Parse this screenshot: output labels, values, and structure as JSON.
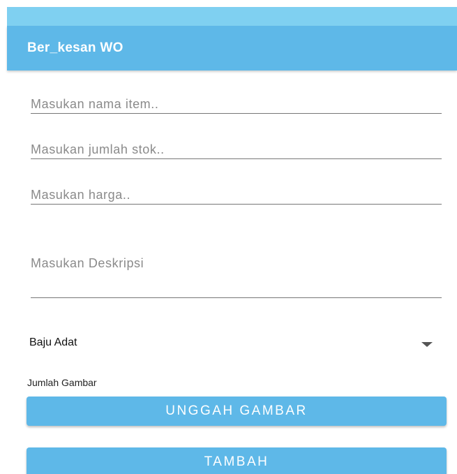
{
  "app": {
    "title": "Ber_kesan WO"
  },
  "form": {
    "nama_placeholder": "Masukan nama item..",
    "stok_placeholder": "Masukan jumlah stok..",
    "harga_placeholder": "Masukan harga..",
    "deskripsi_placeholder": "Masukan Deskripsi",
    "kategori_selected": "Baju Adat",
    "jumlah_gambar_label": "Jumlah Gambar",
    "unggah_button": "UNGGAH GAMBAR",
    "tambah_button": "TAMBAH"
  },
  "colors": {
    "primary": "#5eb8e8",
    "status_bar": "#7fd0f1"
  },
  "icons": {
    "spinner_arrow": "dropdown-arrow-icon"
  }
}
